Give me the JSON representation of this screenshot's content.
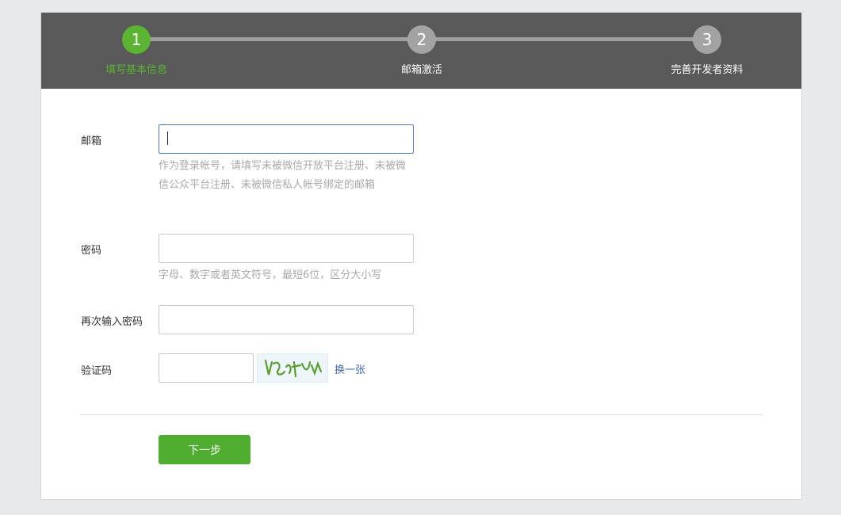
{
  "steps": [
    {
      "number": "1",
      "label": "填写基本信息",
      "state": "active"
    },
    {
      "number": "2",
      "label": "邮箱激活",
      "state": "pending"
    },
    {
      "number": "3",
      "label": "完善开发者资料",
      "state": "pending"
    }
  ],
  "form": {
    "email": {
      "label": "邮箱",
      "value": "",
      "hint": "作为登录帐号，请填写未被微信开放平台注册、未被微信公众平台注册、未被微信私人帐号绑定的邮箱"
    },
    "password": {
      "label": "密码",
      "value": "",
      "hint": "字母、数字或者英文符号，最短6位，区分大小写"
    },
    "confirm_password": {
      "label": "再次输入密码",
      "value": ""
    },
    "captcha": {
      "label": "验证码",
      "value": "",
      "refresh_label": "换一张"
    }
  },
  "actions": {
    "next_label": "下一步"
  },
  "colors": {
    "accent": "#4fae2f",
    "active_step": "#5bb432",
    "header_bg": "#595959",
    "link": "#3e6bb0"
  }
}
